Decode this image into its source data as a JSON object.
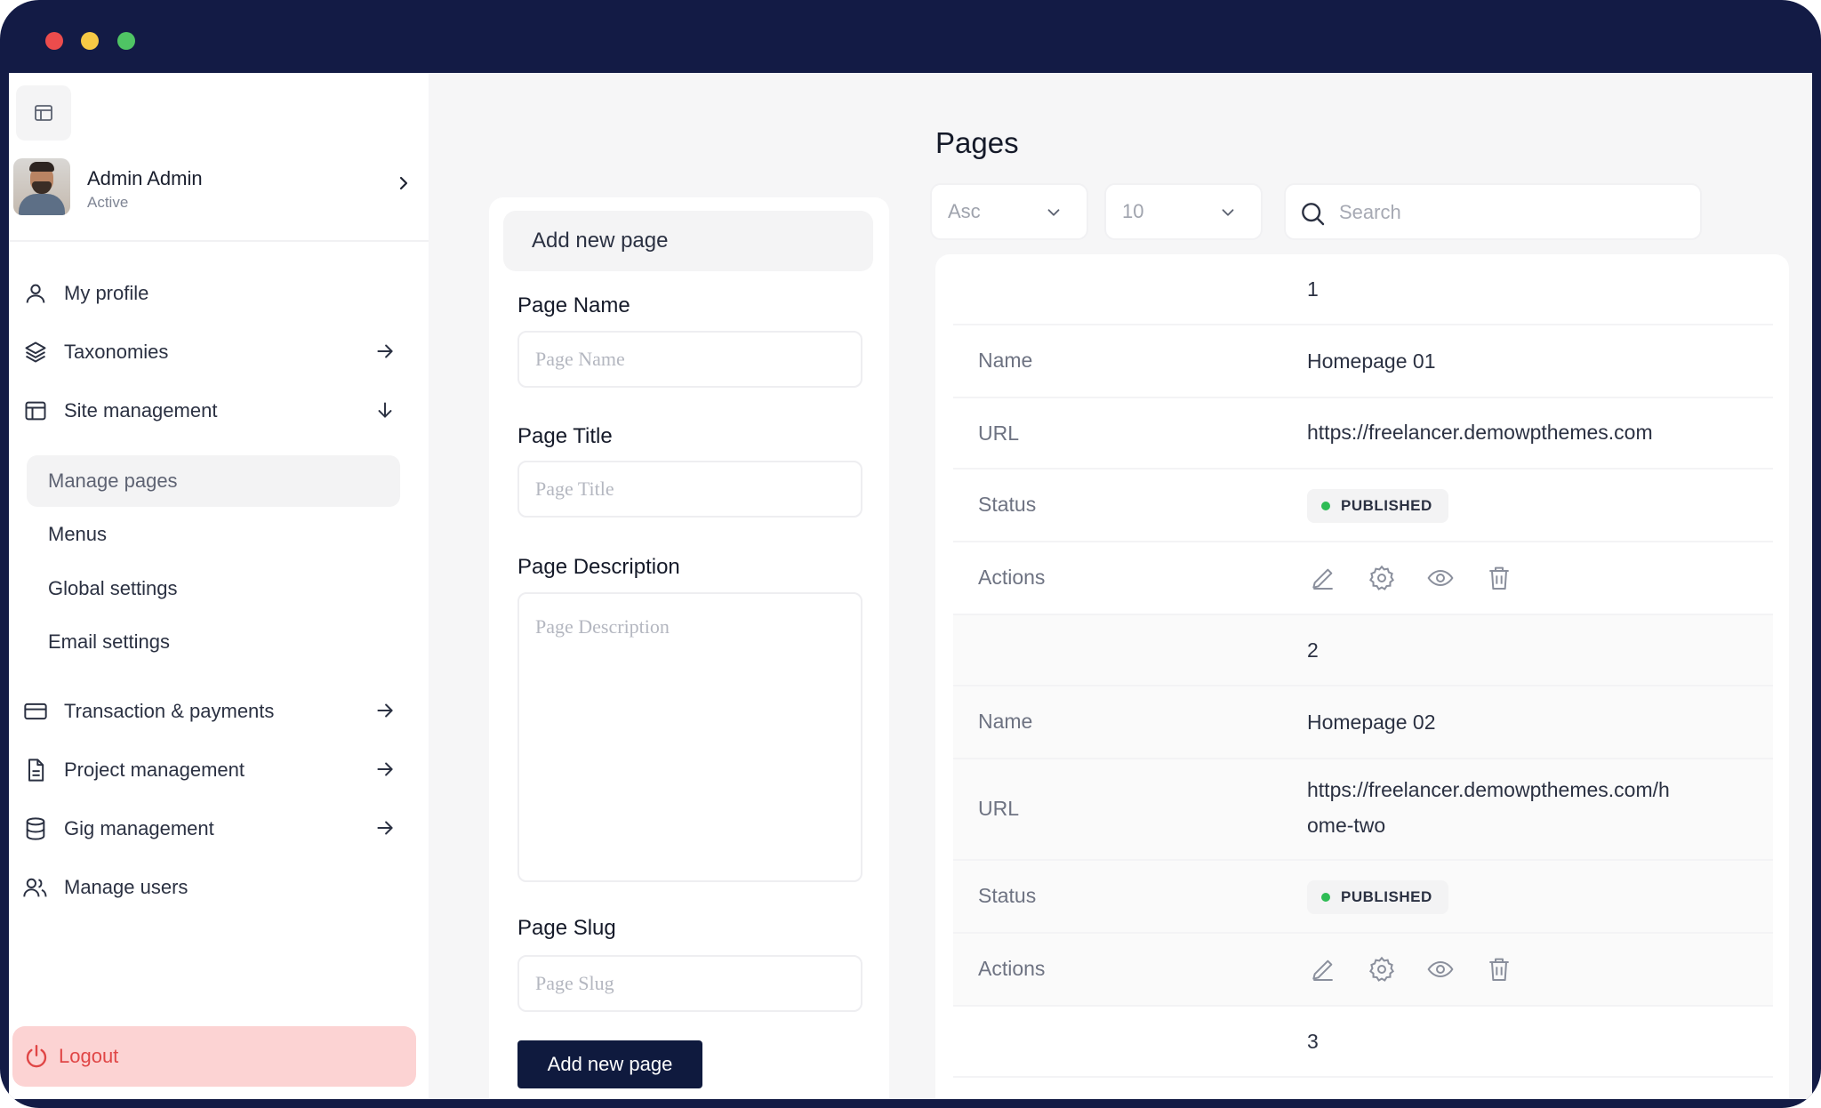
{
  "sidebar": {
    "profile": {
      "name": "Admin Admin",
      "status": "Active"
    },
    "nav": [
      {
        "label": "My profile"
      },
      {
        "label": "Taxonomies"
      },
      {
        "label": "Site management"
      },
      {
        "label": "Transaction & payments"
      },
      {
        "label": "Project management"
      },
      {
        "label": "Gig management"
      },
      {
        "label": "Manage users"
      }
    ],
    "site_management_sub": [
      {
        "label": "Manage pages"
      },
      {
        "label": "Menus"
      },
      {
        "label": "Global settings"
      },
      {
        "label": "Email settings"
      }
    ],
    "logout_label": "Logout"
  },
  "form": {
    "header": "Add new page",
    "page_name": {
      "label": "Page Name",
      "placeholder": "Page Name"
    },
    "page_title": {
      "label": "Page Title",
      "placeholder": "Page Title"
    },
    "page_description": {
      "label": "Page Description",
      "placeholder": "Page Description"
    },
    "page_slug": {
      "label": "Page Slug",
      "placeholder": "Page Slug"
    },
    "submit_label": "Add new page"
  },
  "listing": {
    "title": "Pages",
    "sort_value": "Asc",
    "per_page_value": "10",
    "search_placeholder": "Search",
    "keys": {
      "name": "Name",
      "url": "URL",
      "status": "Status",
      "actions": "Actions"
    },
    "records": [
      {
        "number": "1",
        "name": "Homepage 01",
        "url": "https://freelancer.demowpthemes.com",
        "status": "PUBLISHED"
      },
      {
        "number": "2",
        "name": "Homepage 02",
        "url_line1": "https://freelancer.demowpthemes.com/h",
        "url_line2": "ome-two",
        "status": "PUBLISHED"
      },
      {
        "number": "3"
      }
    ]
  },
  "colors": {
    "frame": "#131b45",
    "primary_button": "#0f1a3e",
    "logout_bg": "#fcd3d3",
    "logout_text": "#e04646",
    "published_dot": "#2ebc55"
  }
}
